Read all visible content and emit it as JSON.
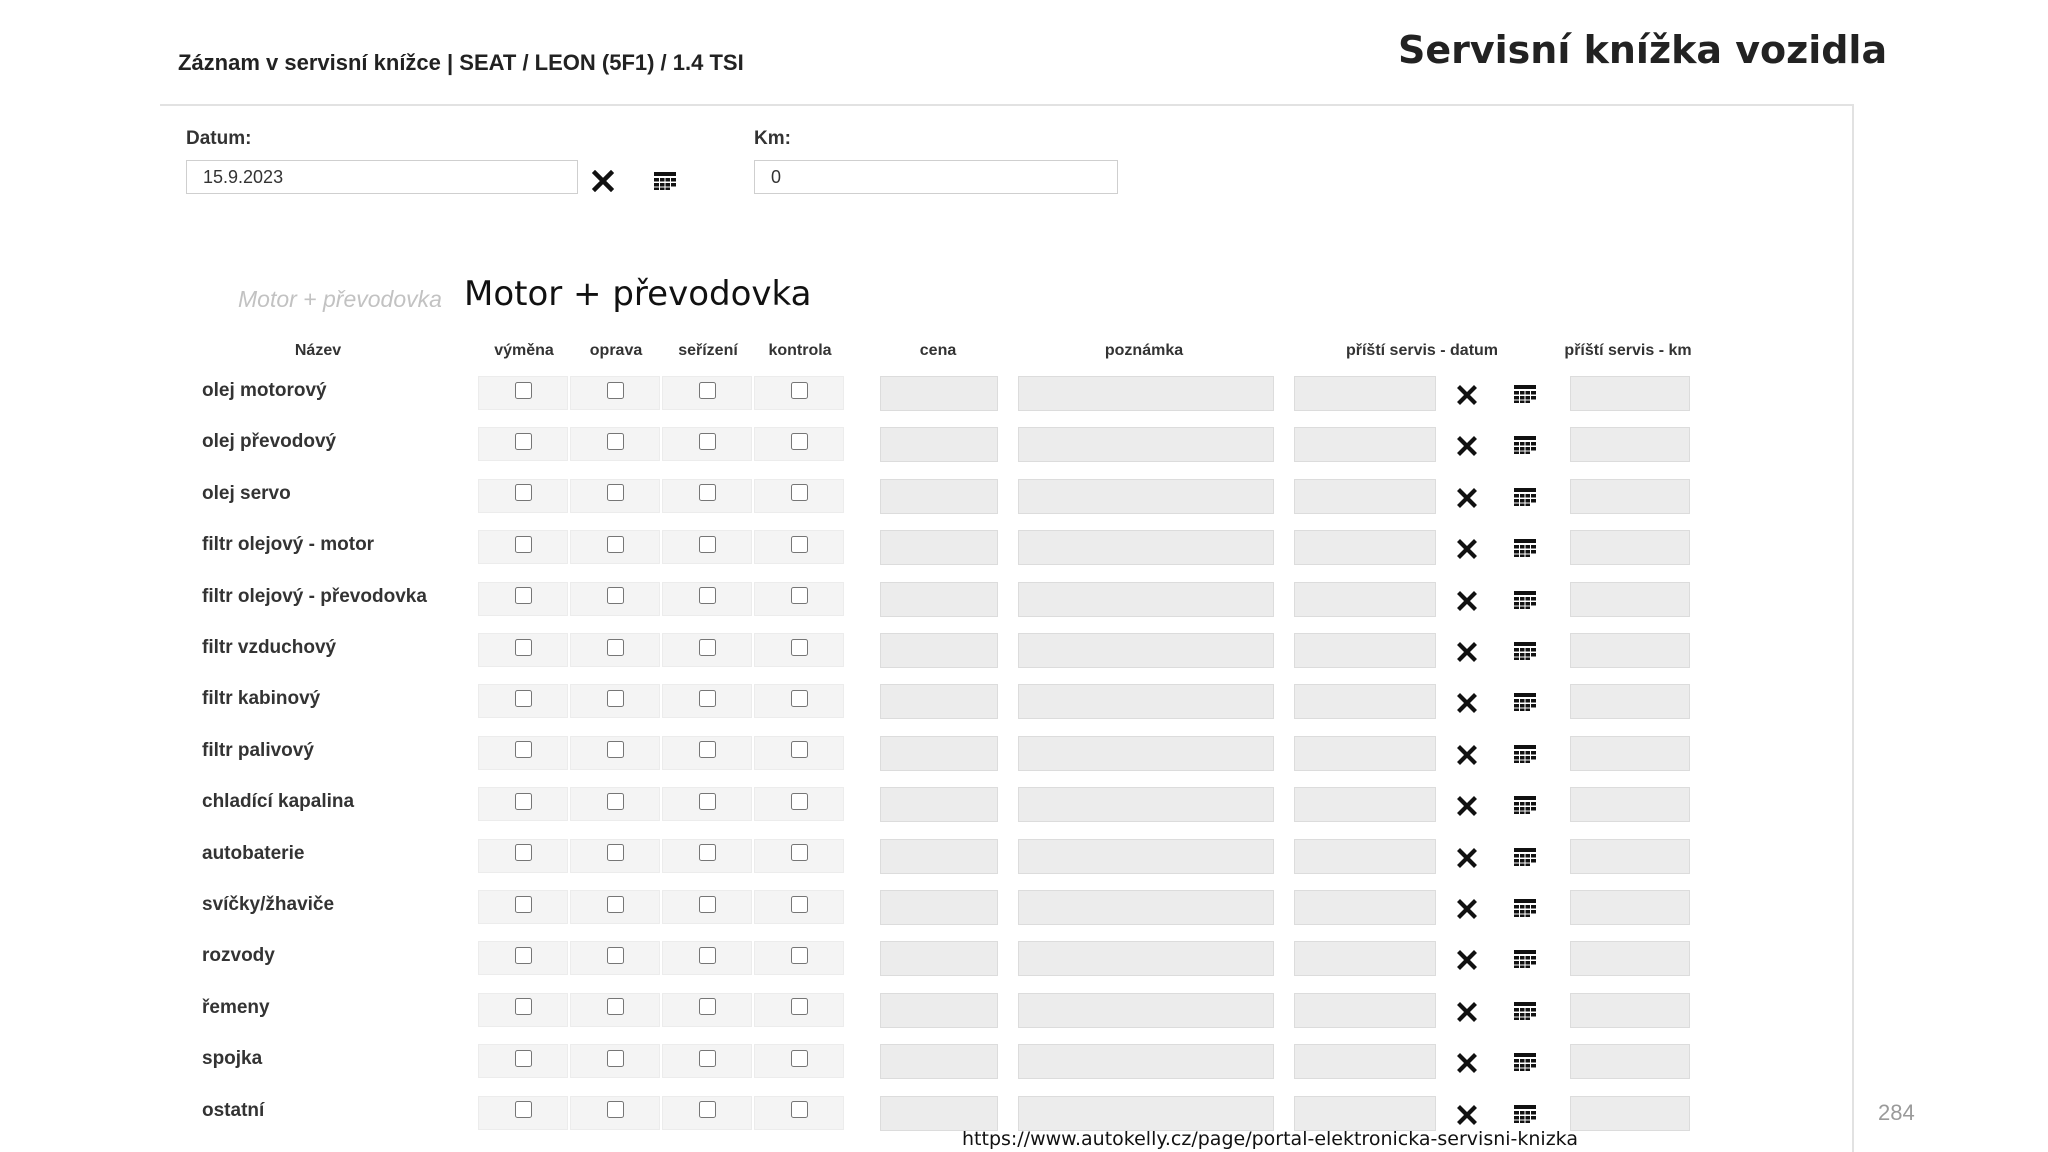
{
  "slide": {
    "title": "Servisní knížka vozidla",
    "page_number": "284",
    "source_url": "https://www.autokelly.cz/page/portal-elektronicka-servisni-knizka"
  },
  "form": {
    "title": "Záznam v servisní knížce | SEAT / LEON (5F1) / 1.4 TSI",
    "date_label": "Datum:",
    "date_value": "15.9.2023",
    "km_label": "Km:",
    "km_value": "0"
  },
  "section": {
    "ghost_label": "Motor + převodovka",
    "title": "Motor + převodovka"
  },
  "columns": {
    "name": "Název",
    "replace": "výměna",
    "repair": "oprava",
    "adjust": "seřízení",
    "check": "kontrola",
    "price": "cena",
    "note": "poznámka",
    "next_date": "příští servis - datum",
    "next_km": "příští servis - km"
  },
  "icons": {
    "clear": "close-x-icon",
    "calendar": "calendar-grid-icon"
  },
  "rows": [
    {
      "name": "olej motorový"
    },
    {
      "name": "olej převodový"
    },
    {
      "name": "olej servo"
    },
    {
      "name": "filtr olejový - motor"
    },
    {
      "name": "filtr olejový - převodovka"
    },
    {
      "name": "filtr vzduchový"
    },
    {
      "name": "filtr kabinový"
    },
    {
      "name": "filtr palivový"
    },
    {
      "name": "chladící kapalina"
    },
    {
      "name": "autobaterie"
    },
    {
      "name": "svíčky/žhaviče"
    },
    {
      "name": "rozvody"
    },
    {
      "name": "řemeny"
    },
    {
      "name": "spojka"
    },
    {
      "name": "ostatní"
    }
  ]
}
